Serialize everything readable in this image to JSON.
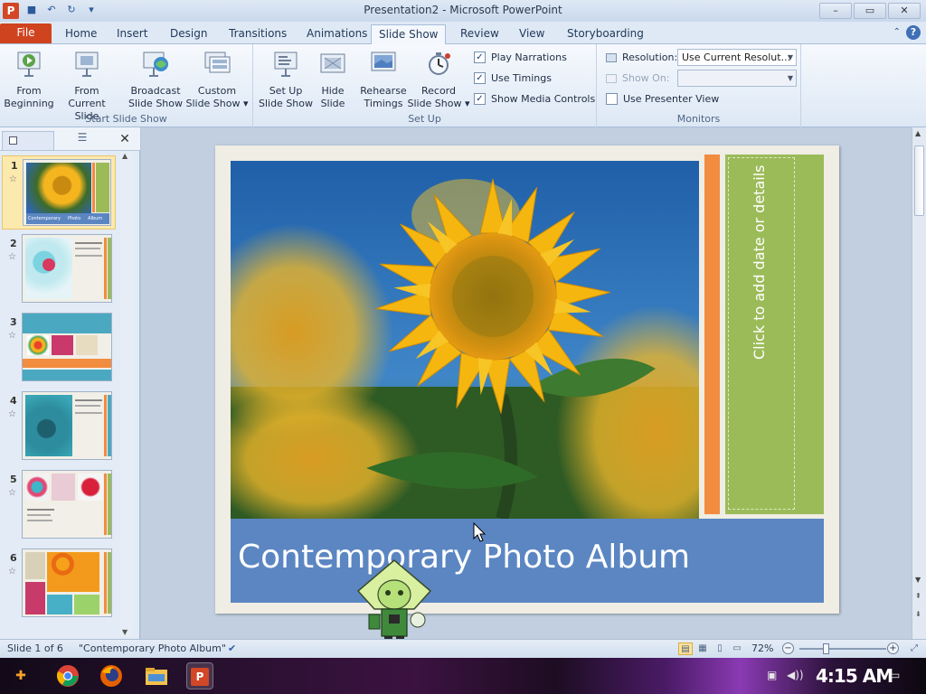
{
  "window": {
    "title": "Presentation2  -  Microsoft PowerPoint",
    "app_icon_letter": "P",
    "minimize": "–",
    "maximize": "▭",
    "close": "✕"
  },
  "tabs": [
    {
      "label": "File"
    },
    {
      "label": "Home"
    },
    {
      "label": "Insert"
    },
    {
      "label": "Design"
    },
    {
      "label": "Transitions"
    },
    {
      "label": "Animations"
    },
    {
      "label": "Slide Show",
      "active": true
    },
    {
      "label": "Review"
    },
    {
      "label": "View"
    },
    {
      "label": "Storyboarding"
    }
  ],
  "ribbon": {
    "start_group": {
      "label": "Start Slide Show",
      "from_beginning": [
        "From",
        "Beginning"
      ],
      "from_current": [
        "From Current",
        "Slide"
      ],
      "broadcast": [
        "Broadcast",
        "Slide Show"
      ],
      "custom": [
        "Custom",
        "Slide Show ▾"
      ]
    },
    "setup_group": {
      "label": "Set Up",
      "setup": [
        "Set Up",
        "Slide Show"
      ],
      "hide": [
        "Hide",
        "Slide"
      ],
      "rehearse": [
        "Rehearse",
        "Timings"
      ],
      "record": [
        "Record",
        "Slide Show ▾"
      ],
      "play_narrations": "Play Narrations",
      "use_timings": "Use Timings",
      "show_media_controls": "Show Media Controls"
    },
    "monitors_group": {
      "label": "Monitors",
      "resolution_label": "Resolution:",
      "resolution_value": "Use Current Resolut...",
      "show_on_label": "Show On:",
      "show_on_value": "",
      "presenter_view": "Use Presenter View"
    }
  },
  "slides": [
    {
      "number": "1"
    },
    {
      "number": "2"
    },
    {
      "number": "3"
    },
    {
      "number": "4"
    },
    {
      "number": "5"
    },
    {
      "number": "6"
    }
  ],
  "thumb1_caption": "Contemporary     Photo     Album",
  "slide": {
    "title": "Contemporary Photo Album",
    "side_placeholder": "Click to add date or details"
  },
  "status": {
    "slide_info": "Slide 1 of 6",
    "theme": "\"Contemporary Photo Album\"",
    "zoom": "72%"
  },
  "taskbar": {
    "clock": "4:15 AM"
  },
  "colors": {
    "file_tab": "#d0431f",
    "title_band": "#5b86c2",
    "green_panel": "#9bbb59",
    "orange_bar": "#f28c3e"
  }
}
